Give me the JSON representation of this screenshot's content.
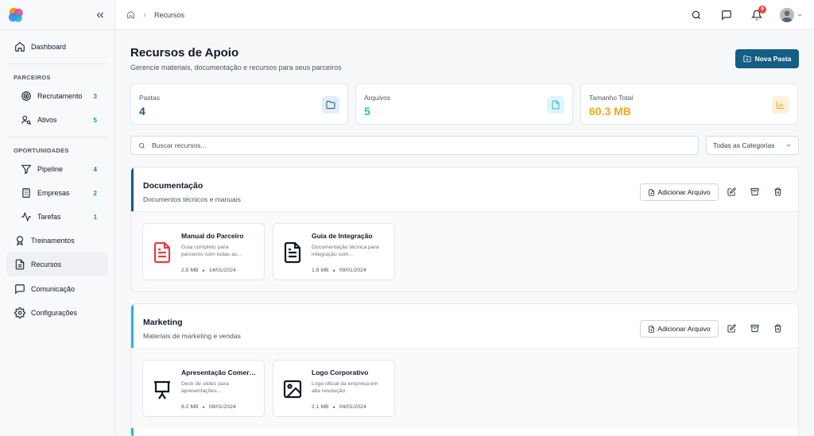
{
  "colors": {
    "primary": "#145e85",
    "count_green": "#16a34a",
    "orange": "#f0a91b",
    "cyan": "#22b8d8",
    "red": "#e53e3e",
    "badge": "#ef4444"
  },
  "sidebar": {
    "dashboard": "Dashboard",
    "section_partners": "PARCEIROS",
    "recrutamento": {
      "label": "Recrutamento",
      "count": "3"
    },
    "ativos": {
      "label": "Ativos",
      "count": "5"
    },
    "section_opportunities": "OPORTUNIDADES",
    "pipeline": {
      "label": "Pipeline",
      "count": "4"
    },
    "empresas": {
      "label": "Empresas",
      "count": "2"
    },
    "tarefas": {
      "label": "Tarefas",
      "count": "1"
    },
    "treinamentos": "Treinamentos",
    "recursos": "Recursos",
    "comunicacao": "Comunicação",
    "configuracoes": "Configurações"
  },
  "topbar": {
    "breadcrumb_current": "Recursos",
    "notification_count": "9"
  },
  "page": {
    "title": "Recursos de Apoio",
    "subtitle": "Gerencie materiais, documentação e recursos para seus parceiros",
    "new_folder_label": "Nova Pasta"
  },
  "stats": {
    "folders": {
      "label": "Pastas",
      "value": "4"
    },
    "files": {
      "label": "Arquivos",
      "value": "5"
    },
    "size": {
      "label": "Tamanho Total",
      "value": "60.3 MB"
    }
  },
  "search": {
    "placeholder": "Buscar recursos...",
    "category": "Todas as Categorias"
  },
  "folders": [
    {
      "name": "Documentação",
      "description": "Documentos técnicos e manuais",
      "add_label": "Adicionar Arquivo",
      "files": [
        {
          "name": "Manual do Parceiro",
          "description": "Guia completo para parceiros com todas as...",
          "size": "2.5 MB",
          "date": "14/01/2024",
          "icon": "file-text-icon"
        },
        {
          "name": "Guia de Integração",
          "description": "Documentação técnica para integração com...",
          "size": "1.8 MB",
          "date": "09/01/2024",
          "icon": "file-text-icon"
        }
      ]
    },
    {
      "name": "Marketing",
      "description": "Materiais de marketing e vendas",
      "add_label": "Adicionar Arquivo",
      "files": [
        {
          "name": "Apresentação Comercial",
          "description": "Deck de slides para apresentações...",
          "size": "8.2 MB",
          "date": "09/01/2024",
          "icon": "presentation-icon"
        },
        {
          "name": "Logo Corporativo",
          "description": "Logo oficial da empresa em alta resolução",
          "size": "2.1 MB",
          "date": "04/01/2024",
          "icon": "image-icon"
        }
      ]
    }
  ]
}
